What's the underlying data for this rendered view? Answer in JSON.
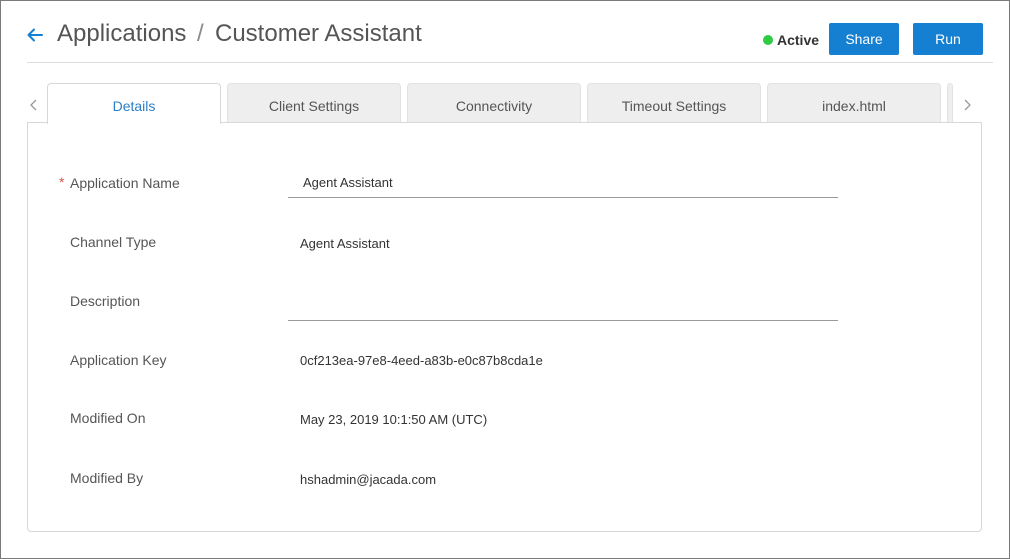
{
  "header": {
    "breadcrumb_root": "Applications",
    "breadcrumb_separator": "/",
    "breadcrumb_current": "Customer Assistant",
    "status_label": "Active",
    "status_color": "#2ecc40",
    "share_label": "Share",
    "run_label": "Run",
    "accent_color": "#1580d2"
  },
  "tabs": [
    {
      "label": "Details",
      "active": true
    },
    {
      "label": "Client Settings",
      "active": false
    },
    {
      "label": "Connectivity",
      "active": false
    },
    {
      "label": "Timeout Settings",
      "active": false
    },
    {
      "label": "index.html",
      "active": false
    }
  ],
  "form": {
    "required_marker": "*",
    "application_name_label": "Application Name",
    "application_name_value": "Agent Assistant",
    "channel_type_label": "Channel Type",
    "channel_type_value": "Agent Assistant",
    "description_label": "Description",
    "description_value": "",
    "application_key_label": "Application Key",
    "application_key_value": "0cf213ea-97e8-4eed-a83b-e0c87b8cda1e",
    "modified_on_label": "Modified On",
    "modified_on_value": "May 23, 2019 10:1:50 AM (UTC)",
    "modified_by_label": "Modified By",
    "modified_by_value": "hshadmin@jacada.com"
  },
  "icons": {
    "back": "arrow-left-icon",
    "tab_scroll_left": "chevron-left-icon",
    "tab_scroll_right": "chevron-right-icon"
  }
}
